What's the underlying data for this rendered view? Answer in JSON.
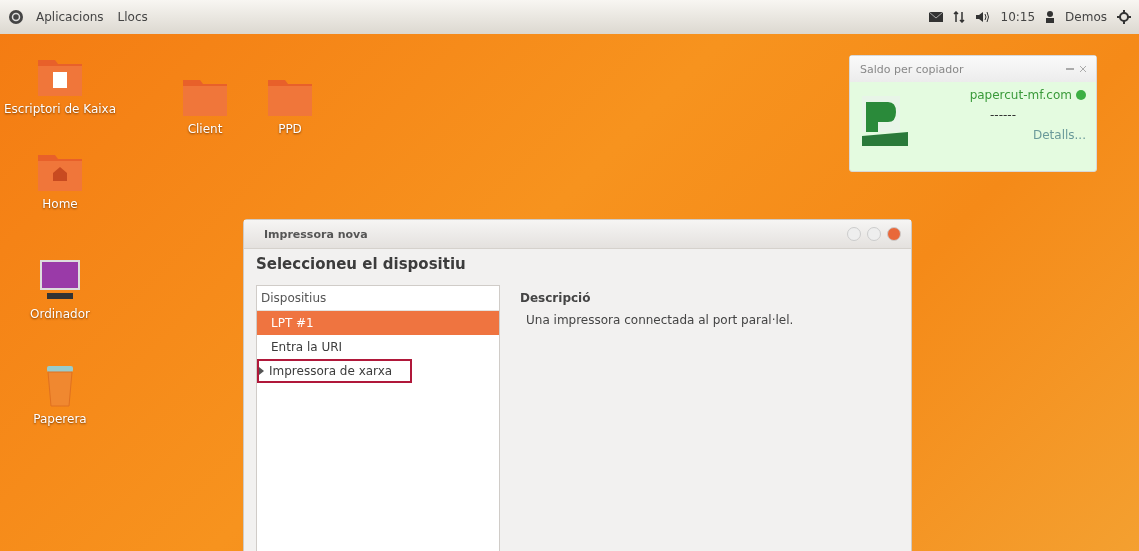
{
  "top_panel": {
    "menus": [
      "Aplicacions",
      "Llocs"
    ],
    "clock": "10:15",
    "user": "Demos"
  },
  "desktop_icons": [
    {
      "kind": "folder-doc",
      "label": "Escriptori de Kaixa"
    },
    {
      "kind": "folder",
      "label": "Client"
    },
    {
      "kind": "folder",
      "label": "PPD"
    },
    {
      "kind": "home",
      "label": "Home"
    },
    {
      "kind": "computer",
      "label": "Ordinador"
    },
    {
      "kind": "trash",
      "label": "Paperera"
    }
  ],
  "balance_widget": {
    "title": "Saldo per copiador",
    "server": "papercut-mf.com",
    "balance": "------",
    "link": "Detalls..."
  },
  "dialog": {
    "title": "Impressora nova",
    "heading": "Seleccioneu el dispositiu",
    "list_header": "Dispositius",
    "devices": [
      {
        "label": "LPT #1",
        "selected": true,
        "kind": "leaf",
        "highlighted": false
      },
      {
        "label": "Entra la URI",
        "selected": false,
        "kind": "leaf",
        "highlighted": false
      },
      {
        "label": "Impressora de xarxa",
        "selected": false,
        "kind": "group",
        "expanded": false,
        "highlighted": true
      }
    ],
    "description_label": "Descripció",
    "description": "Una impressora connectada al port paral·lel."
  }
}
